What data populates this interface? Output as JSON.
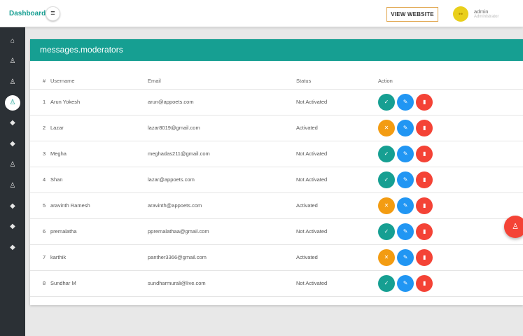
{
  "header": {
    "brand": "Dashboard",
    "menu_icon": "≡",
    "view_website_label": "VIEW WEBSITE",
    "user": {
      "name": "admin",
      "role": "Administrator",
      "avatar_icon": "••"
    }
  },
  "sidebar": {
    "items": [
      {
        "icon": "home-icon",
        "glyph": "⌂"
      },
      {
        "icon": "user-icon",
        "glyph": "♙"
      },
      {
        "icon": "user-icon",
        "glyph": "♙"
      },
      {
        "icon": "user-icon",
        "glyph": "♙",
        "active": true
      },
      {
        "icon": "tag-icon",
        "glyph": "◆"
      },
      {
        "icon": "tag-icon",
        "glyph": "◆"
      },
      {
        "icon": "user-icon",
        "glyph": "♙"
      },
      {
        "icon": "user-icon",
        "glyph": "♙"
      },
      {
        "icon": "tag-icon",
        "glyph": "◆"
      },
      {
        "icon": "tag-icon",
        "glyph": "◆"
      },
      {
        "icon": "tag-icon",
        "glyph": "◆"
      }
    ]
  },
  "card": {
    "title": "messages.moderators"
  },
  "table": {
    "headers": {
      "num": "#",
      "username": "Username",
      "email": "Email",
      "status": "Status",
      "action": "Action"
    },
    "rows": [
      {
        "num": "1",
        "username": "Arun Yokesh",
        "email": "arun@appoets.com",
        "status": "Not Activated"
      },
      {
        "num": "2",
        "username": "Lazar",
        "email": "lazar8019@gmail.com",
        "status": "Activated"
      },
      {
        "num": "3",
        "username": "Megha",
        "email": "meghadas211@gmail.com",
        "status": "Not Activated"
      },
      {
        "num": "4",
        "username": "Shan",
        "email": "lazar@appoets.com",
        "status": "Not Activated"
      },
      {
        "num": "5",
        "username": "aravinth Ramesh",
        "email": "aravinth@appoets.com",
        "status": "Activated"
      },
      {
        "num": "6",
        "username": "premalatha",
        "email": "ppremalathaa@gmail.com",
        "status": "Not Activated"
      },
      {
        "num": "7",
        "username": "karthik",
        "email": "panther3366@gmail.com",
        "status": "Activated"
      },
      {
        "num": "8",
        "username": "Sundhar M",
        "email": "sundharmurali@live.com",
        "status": "Not Activated"
      }
    ],
    "action_glyphs": {
      "activate": "✓",
      "deactivate": "✕",
      "edit": "✎",
      "delete": "▮"
    }
  },
  "colors": {
    "accent": "#169f92",
    "sidebar": "#2b3035",
    "activate": "#169f92",
    "deactivate": "#f39c12",
    "edit": "#2196f3",
    "delete": "#f44336",
    "button_border": "#e0a44a"
  },
  "fab": {
    "icon": "user-icon",
    "glyph": "♙"
  }
}
